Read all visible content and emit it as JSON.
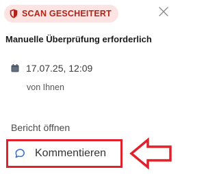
{
  "status_badge": {
    "label": "SCAN GESCHEITERT",
    "icon": "shield-icon",
    "text_color": "#b42318",
    "background": "#fde3e1"
  },
  "close_icon": "close-icon",
  "title": "Manuelle Überprüfung erforderlich",
  "meta": {
    "date_icon": "calendar-icon",
    "date": "17.07.25, 12:09",
    "author": "von Ihnen"
  },
  "actions": {
    "open_report": "Bericht öffnen",
    "comment": "Kommentieren",
    "comment_icon": "comment-bubble-icon"
  },
  "annotation": {
    "highlight_color": "#e0202a",
    "arrow_icon": "left-arrow-icon"
  }
}
